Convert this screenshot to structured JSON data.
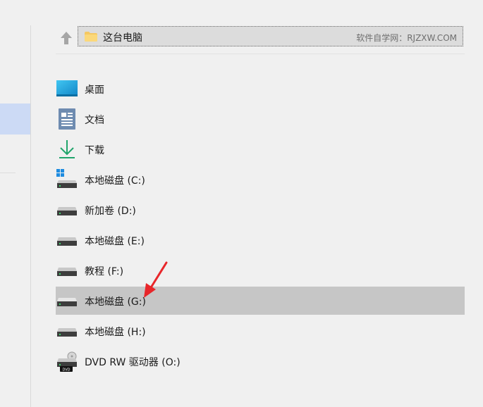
{
  "address": {
    "path": "这台电脑",
    "watermark": "软件自学网：RJZXW.COM"
  },
  "items": [
    {
      "label": "桌面",
      "icon": "desktop-icon"
    },
    {
      "label": "文档",
      "icon": "documents-icon"
    },
    {
      "label": "下载",
      "icon": "downloads-icon"
    },
    {
      "label": "本地磁盘 (C:)",
      "icon": "system-drive-icon"
    },
    {
      "label": "新加卷 (D:)",
      "icon": "drive-icon"
    },
    {
      "label": "本地磁盘 (E:)",
      "icon": "drive-icon"
    },
    {
      "label": "教程 (F:)",
      "icon": "drive-icon"
    },
    {
      "label": "本地磁盘 (G:)",
      "icon": "drive-icon",
      "selected": true
    },
    {
      "label": "本地磁盘 (H:)",
      "icon": "drive-icon"
    },
    {
      "label": "DVD RW 驱动器 (O:)",
      "icon": "dvd-drive-icon"
    }
  ],
  "colors": {
    "selection": "#c6c6c6",
    "nav_selection": "#ccdaf5",
    "annotation_arrow": "#e8262a"
  }
}
